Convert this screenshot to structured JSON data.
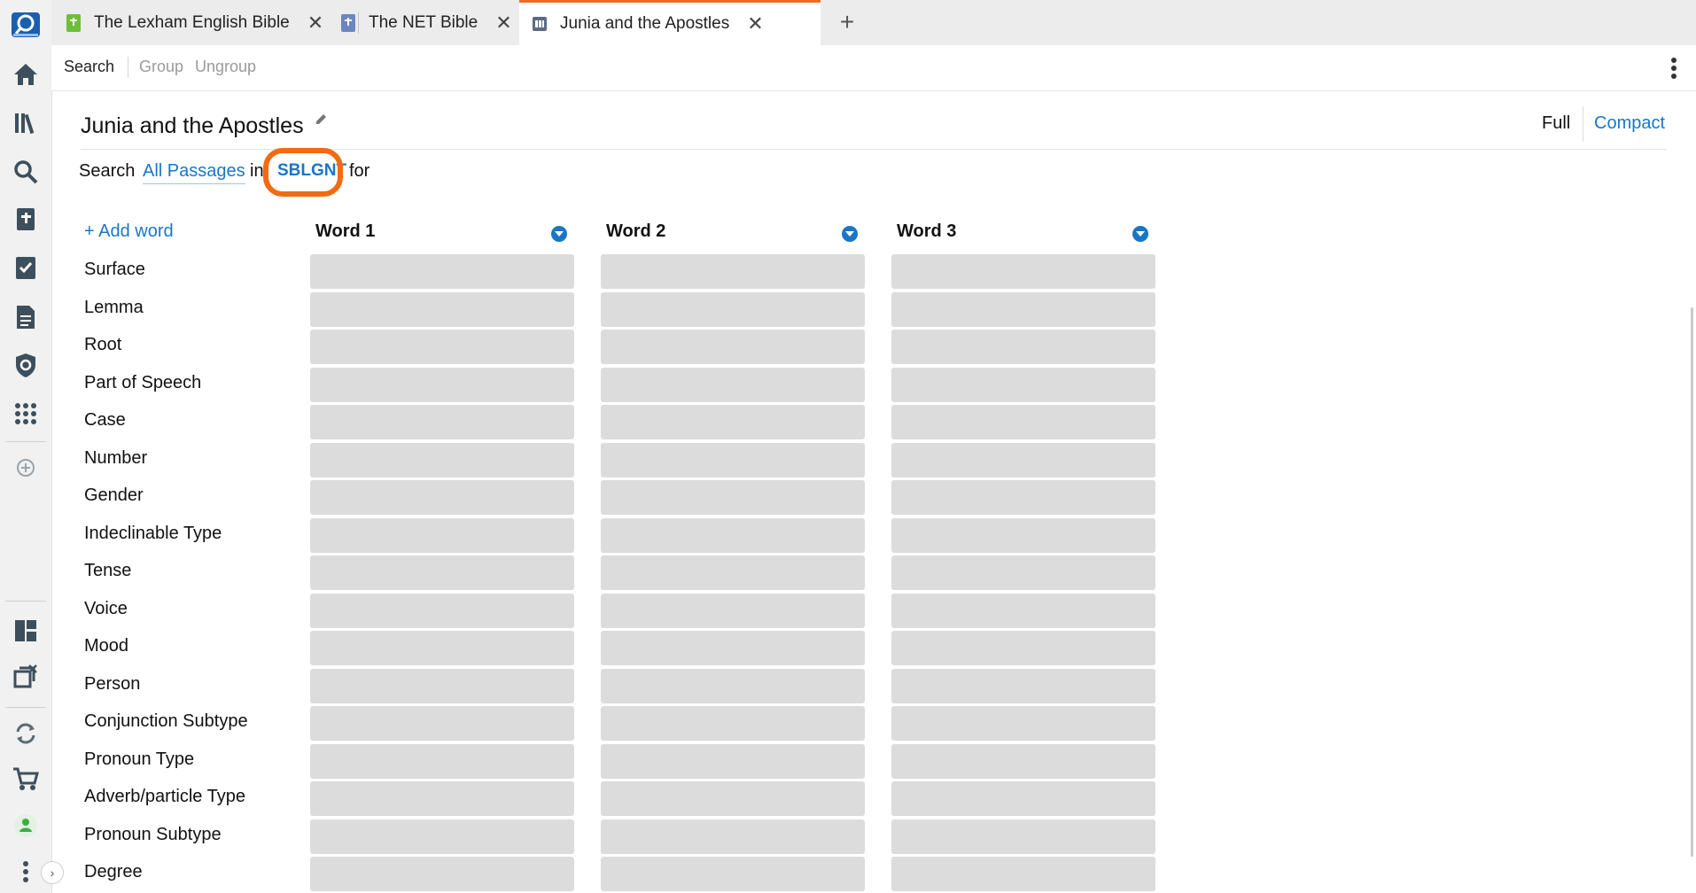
{
  "rail": {
    "icons": [
      "logos-app-icon",
      "home-icon",
      "library-icon",
      "search-icon",
      "bible-icon",
      "checklist-icon",
      "document-icon",
      "shield-icon",
      "apps-grid-icon",
      "add-panel-icon",
      "layout-icon",
      "close-panels-icon",
      "sync-icon",
      "cart-icon",
      "account-icon",
      "more-vertical-icon"
    ]
  },
  "tabs": [
    {
      "title": "The Lexham English Bible",
      "icon": "bible-book-green-icon",
      "active": false
    },
    {
      "title": "The NET Bible",
      "icon": "bible-book-blue-icon",
      "active": false
    },
    {
      "title": "Junia and the Apostles",
      "icon": "search-doc-icon",
      "active": true
    }
  ],
  "tab_close_glyph": "✕",
  "new_tab_glyph": "+",
  "toolbar": {
    "search": "Search",
    "group": "Group",
    "ungroup": "Ungroup"
  },
  "document": {
    "title": "Junia and the Apostles",
    "view_full": "Full",
    "view_compact": "Compact"
  },
  "search_line": {
    "prefix": "Search",
    "range": "All Passages",
    "in": "in",
    "resource": "SBLGNT",
    "suffix": "for"
  },
  "grid": {
    "add_word": "+ Add word",
    "columns": [
      "Word 1",
      "Word 2",
      "Word 3"
    ],
    "rows": [
      "Surface",
      "Lemma",
      "Root",
      "Part of Speech",
      "Case",
      "Number",
      "Gender",
      "Indeclinable Type",
      "Tense",
      "Voice",
      "Mood",
      "Person",
      "Conjunction Subtype",
      "Pronoun Type",
      "Adverb/particle Type",
      "Pronoun Subtype",
      "Degree"
    ]
  },
  "colors": {
    "accent": "#1976c7",
    "highlight": "#f26a12",
    "active_tab_border": "#f06a1e",
    "cell": "#dcdcdc"
  }
}
